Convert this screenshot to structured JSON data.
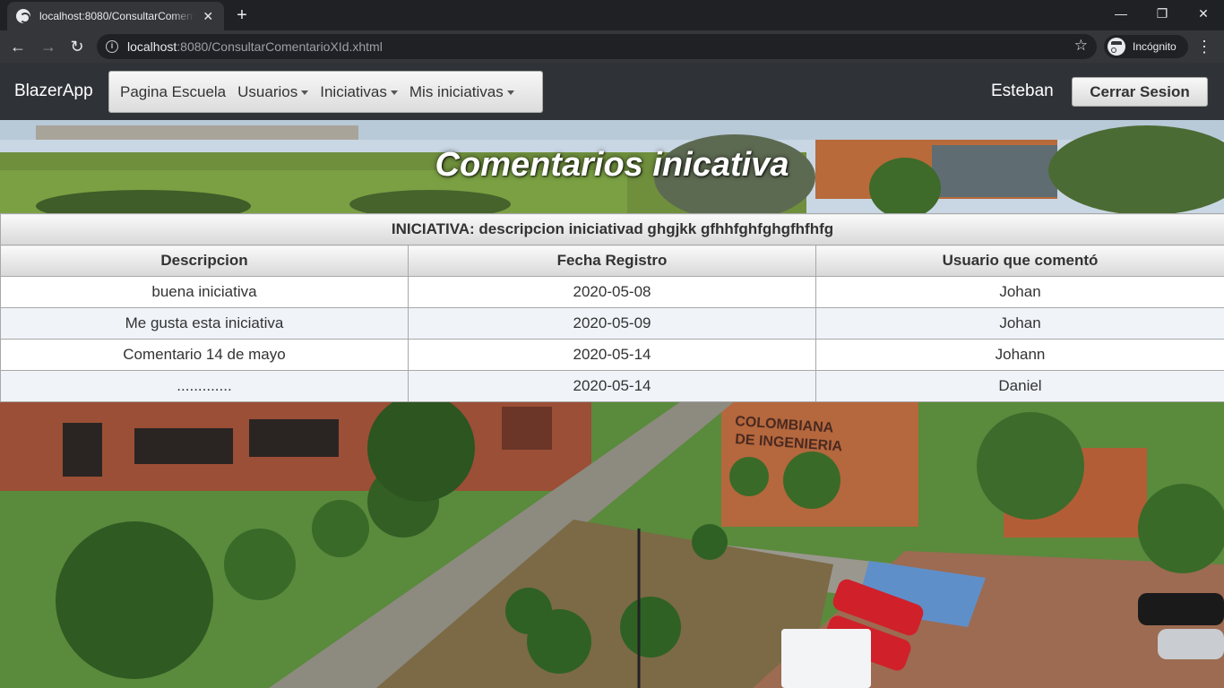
{
  "browser": {
    "tab_title": "localhost:8080/ConsultarComentarioXId.xhtml",
    "url_host": "localhost",
    "url_rest": ":8080/ConsultarComentarioXId.xhtml",
    "incognito_label": "Incógnito"
  },
  "navbar": {
    "brand": "BlazerApp",
    "menu": [
      {
        "label": "Pagina Escuela",
        "has_caret": false
      },
      {
        "label": "Usuarios",
        "has_caret": true
      },
      {
        "label": "Iniciativas",
        "has_caret": true
      },
      {
        "label": "Mis iniciativas",
        "has_caret": true
      }
    ],
    "user_name": "Esteban",
    "logout_label": "Cerrar Sesion"
  },
  "hero": {
    "title": "Comentarios inicativa"
  },
  "table": {
    "caption": "INICIATIVA: descripcion iniciativad ghgjkk gfhhfghfghgfhfhfg",
    "columns": [
      "Descripcion",
      "Fecha Registro",
      "Usuario que comentó"
    ],
    "rows": [
      [
        "buena iniciativa",
        "2020-05-08",
        "Johan"
      ],
      [
        "Me gusta esta iniciativa",
        "2020-05-09",
        "Johan"
      ],
      [
        "Comentario 14 de mayo",
        "2020-05-14",
        "Johann"
      ],
      [
        ".............",
        "2020-05-14",
        "Daniel"
      ]
    ]
  },
  "background_photo": {
    "sign_text": "COLOMBIANA DE INGENIERIA"
  },
  "colors": {
    "chrome_dark": "#202124",
    "chrome_toolbar": "#35363a",
    "navbar": "#2f3338",
    "row_alt": "#f0f4f9"
  }
}
